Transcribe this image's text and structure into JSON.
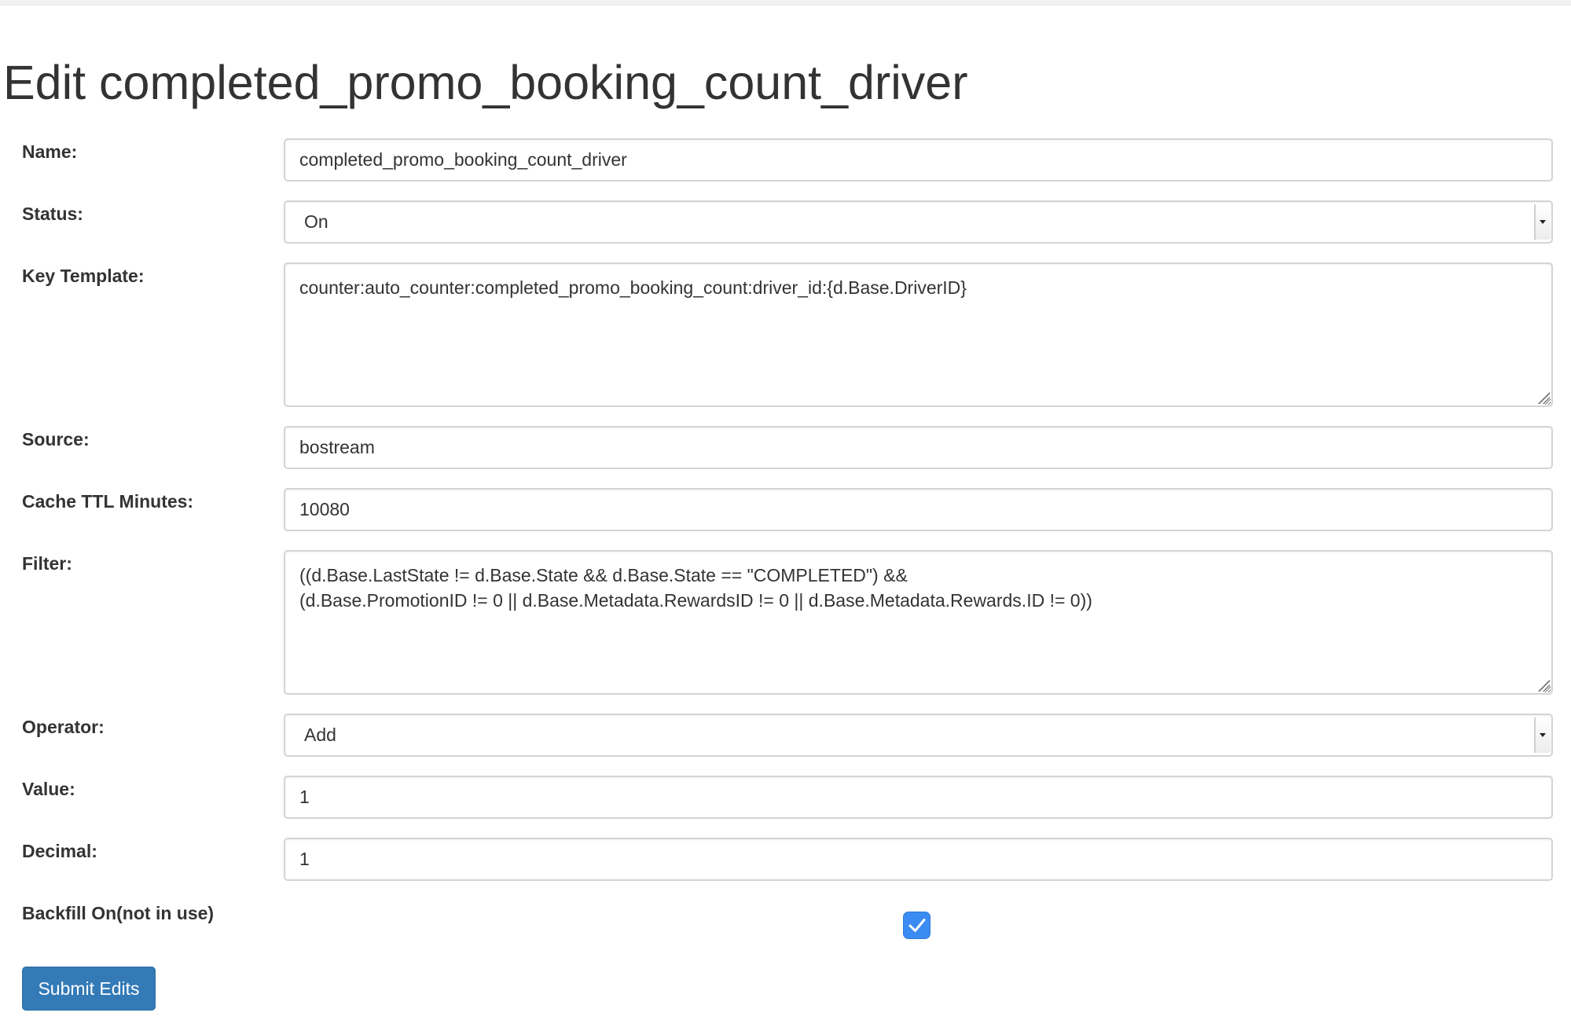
{
  "page": {
    "title": "Edit completed_promo_booking_count_driver"
  },
  "form": {
    "name": {
      "label": "Name:",
      "value": "completed_promo_booking_count_driver"
    },
    "status": {
      "label": "Status:",
      "value": "On"
    },
    "key_template": {
      "label": "Key Template:",
      "value": "counter:auto_counter:completed_promo_booking_count:driver_id:{d.Base.DriverID}"
    },
    "source": {
      "label": "Source:",
      "value": "bostream"
    },
    "cache_ttl_minutes": {
      "label": "Cache TTL Minutes:",
      "value": "10080"
    },
    "filter": {
      "label": "Filter:",
      "value": "((d.Base.LastState != d.Base.State && d.Base.State == \"COMPLETED\") &&\n(d.Base.PromotionID != 0 || d.Base.Metadata.RewardsID != 0 || d.Base.Metadata.Rewards.ID != 0))"
    },
    "operator": {
      "label": "Operator:",
      "value": "Add"
    },
    "value": {
      "label": "Value:",
      "value": "1"
    },
    "decimal": {
      "label": "Decimal:",
      "value": "1"
    },
    "backfill": {
      "label": "Backfill On(not in use)",
      "checked": true
    },
    "submit_label": "Submit Edits"
  },
  "colors": {
    "primary_button": "#337ab7",
    "checkbox_checked": "#3b8cf2"
  },
  "icons": {
    "checkbox": "checkmark-icon",
    "select": "chevron-down-icon",
    "textarea": "resize-grip-icon"
  }
}
